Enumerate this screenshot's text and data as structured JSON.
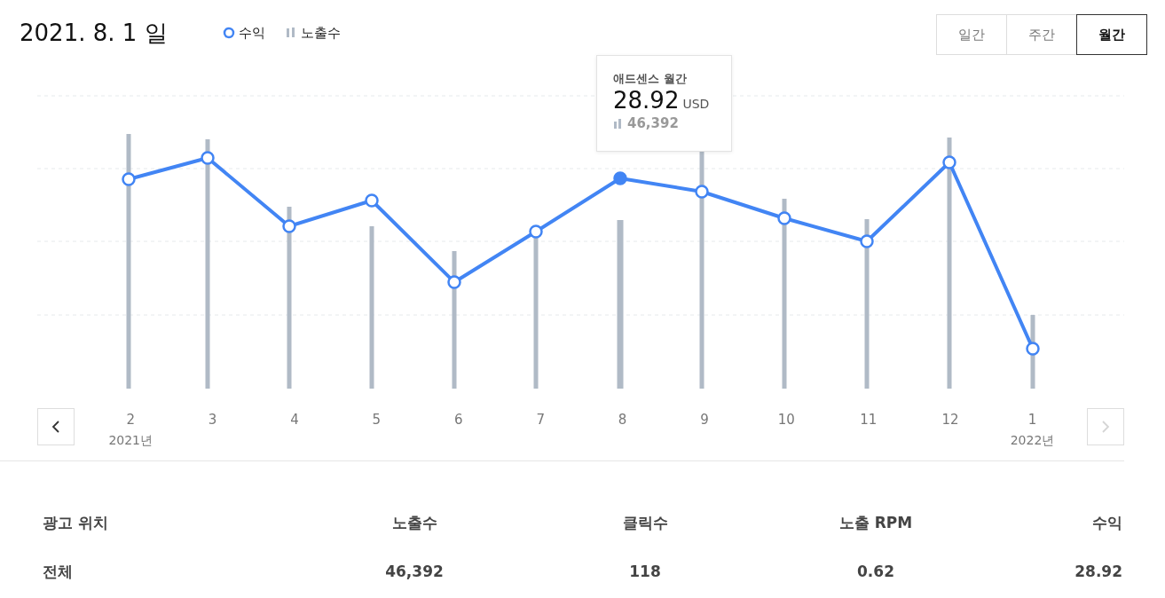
{
  "title": "2021. 8. 1 일",
  "legend": [
    {
      "kind": "line",
      "label": "수익"
    },
    {
      "kind": "bar",
      "label": "노출수"
    }
  ],
  "period_tabs": [
    {
      "label": "일간",
      "selected": false
    },
    {
      "label": "주간",
      "selected": false
    },
    {
      "label": "월간",
      "selected": true
    }
  ],
  "tooltip": {
    "title": "애드센스 월간",
    "value": "28.92",
    "unit": "USD",
    "impressions": "46,392"
  },
  "months": [
    {
      "label": "2",
      "year": "2021년",
      "selected": false
    },
    {
      "label": "3",
      "selected": false
    },
    {
      "label": "4",
      "selected": false
    },
    {
      "label": "5",
      "selected": false
    },
    {
      "label": "6",
      "selected": false
    },
    {
      "label": "7",
      "selected": false
    },
    {
      "label": "8",
      "selected": true
    },
    {
      "label": "9",
      "selected": false
    },
    {
      "label": "10",
      "selected": false
    },
    {
      "label": "11",
      "selected": false
    },
    {
      "label": "12",
      "selected": false
    },
    {
      "label": "1",
      "year": "2022년",
      "selected": false
    }
  ],
  "prev_button": {
    "disabled": false
  },
  "next_button": {
    "disabled": true
  },
  "table": {
    "columns": [
      "광고 위치",
      "노출수",
      "클릭수",
      "노출 RPM",
      "수익"
    ],
    "rows": [
      [
        "전체",
        "46,392",
        "118",
        "0.62",
        "28.92"
      ]
    ]
  }
}
